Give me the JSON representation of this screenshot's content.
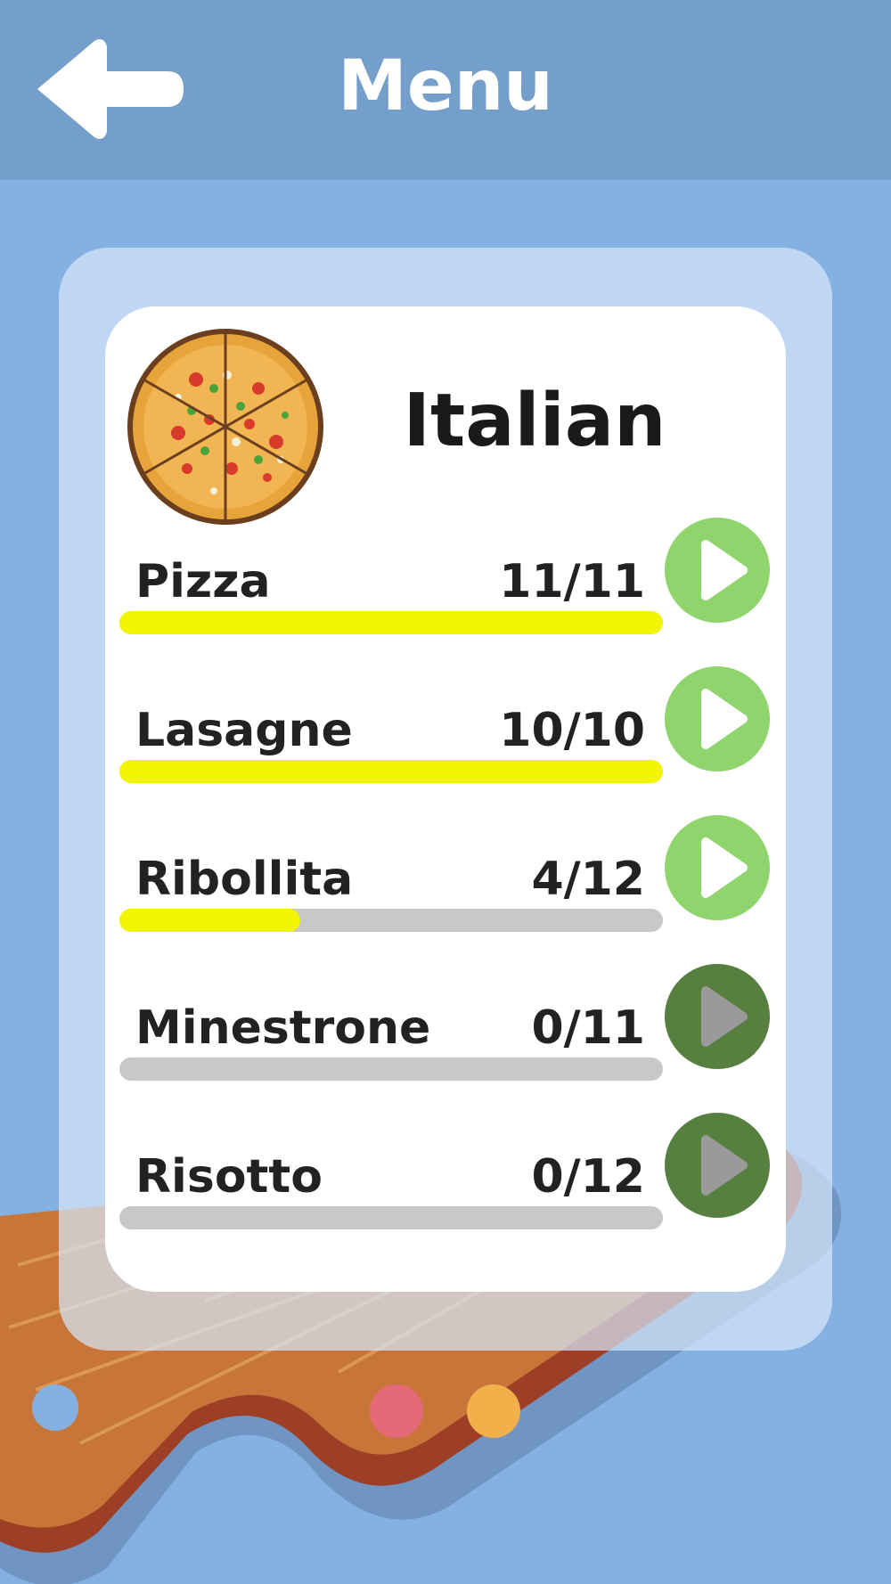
{
  "header": {
    "title": "Menu",
    "back_icon": "arrow-left-icon"
  },
  "category": {
    "title": "Italian",
    "image": "pizza-image"
  },
  "dishes": [
    {
      "name": "Pizza",
      "progress_text": "11/11",
      "completed": 11,
      "total": 11,
      "fraction": 1.0,
      "unlocked": true
    },
    {
      "name": "Lasagne",
      "progress_text": "10/10",
      "completed": 10,
      "total": 10,
      "fraction": 1.0,
      "unlocked": true
    },
    {
      "name": "Ribollita",
      "progress_text": "4/12",
      "completed": 4,
      "total": 12,
      "fraction": 0.333,
      "unlocked": true
    },
    {
      "name": "Minestrone",
      "progress_text": "0/11",
      "completed": 0,
      "total": 11,
      "fraction": 0.0,
      "unlocked": false
    },
    {
      "name": "Risotto",
      "progress_text": "0/12",
      "completed": 0,
      "total": 12,
      "fraction": 0.0,
      "unlocked": false
    }
  ],
  "colors": {
    "background": "#85b1e2",
    "header": "#759fcb",
    "progress_fill": "#f3f400",
    "progress_track": "#c8c8c6",
    "play_enabled": "#90d46d",
    "play_disabled": "#567f40"
  }
}
